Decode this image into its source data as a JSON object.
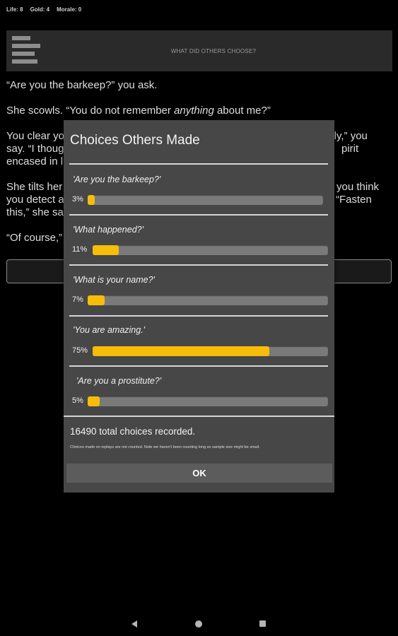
{
  "status": {
    "life": "Life: 8",
    "gold": "Gold: 4",
    "morale": "Morale: 0"
  },
  "header": {
    "title": "WHAT DID OTHERS CHOOSE?"
  },
  "story": {
    "p1": "“Are you the barkeep?” you ask.",
    "p2_before": "She scowls. “You do not remember ",
    "p2_emph": "anything",
    "p2_after": " about me?”",
    "p3_line1": "You clear yo",
    "p3_line1_tail": "ctly,” you",
    "p3_line2": "say. “I thoug",
    "p3_line2_tail": "pirit",
    "p3_line3": "encased in l",
    "p4_line1": "She tilts her",
    "p4_line1_tail": "you think",
    "p4_line2": "you detect a",
    "p4_line2_tail": "“Fasten",
    "p4_line3": "this,” she sa",
    "p5": "“Of course,”"
  },
  "modal": {
    "title": "Choices Others Made",
    "choices": [
      {
        "label": "'Are you the barkeep?'",
        "percent_label": "3%",
        "percent": 3
      },
      {
        "label": "'What happened?'",
        "percent_label": "11%",
        "percent": 11
      },
      {
        "label": "'What is your name?'",
        "percent_label": "7%",
        "percent": 7
      },
      {
        "label": "'You are amazing.'",
        "percent_label": "75%",
        "percent": 75
      },
      {
        "label": "'Are you a prostitute?'",
        "percent_label": "5%",
        "percent": 5
      }
    ],
    "total": "16490 total choices recorded.",
    "note": "Choices made on replays are not counted. Note we haven't been counting long so sample size might be small.",
    "ok_label": "OK"
  },
  "colors": {
    "bar_fill": "#f7bd08",
    "bar_track": "#7a7a7a",
    "modal_bg": "#474747"
  },
  "icons": {
    "menu": "menu-icon",
    "nav_back": "back-triangle-icon",
    "nav_home": "home-circle-icon",
    "nav_recents": "recents-square-icon"
  }
}
